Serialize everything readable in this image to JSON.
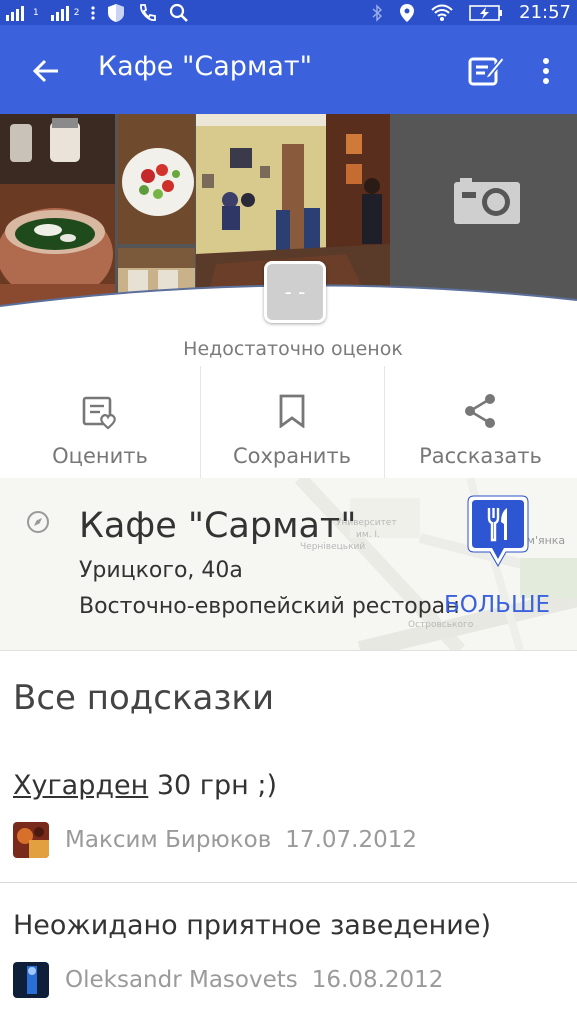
{
  "status_bar": {
    "time": "21:57",
    "sim1": "1",
    "sim2": "2"
  },
  "app_bar": {
    "title": "Кафе \"Сармат\"",
    "background": "#3b62dc",
    "status_background": "#2c50c9"
  },
  "photos": {
    "rating_placeholder": "- -",
    "add_photo_icon": "camera-icon"
  },
  "rating_note": "Недостаточно оценок",
  "actions": [
    {
      "label": "Оценить",
      "icon": "rate-icon"
    },
    {
      "label": "Сохранить",
      "icon": "bookmark-icon"
    },
    {
      "label": "Рассказать",
      "icon": "share-icon"
    }
  ],
  "venue": {
    "name": "Кафе \"Сармат\"",
    "address": "Урицкого, 40а",
    "category": "Восточно-европейский ресторан",
    "more_label": "БОЛЬШЕ",
    "map_labels": [
      "Университет",
      "им. І.",
      "Чернівецький",
      "Ом'янка",
      "Островського"
    ]
  },
  "tips": {
    "section_title": "Все подсказки",
    "items": [
      {
        "linked": "Хугарден",
        "text": " 30 грн ;)",
        "author": "Максим Бирюков",
        "date": "17.07.2012"
      },
      {
        "linked": "",
        "text": "Неожидано приятное заведение)",
        "author": "Oleksandr Masovets",
        "date": "16.08.2012"
      }
    ]
  }
}
